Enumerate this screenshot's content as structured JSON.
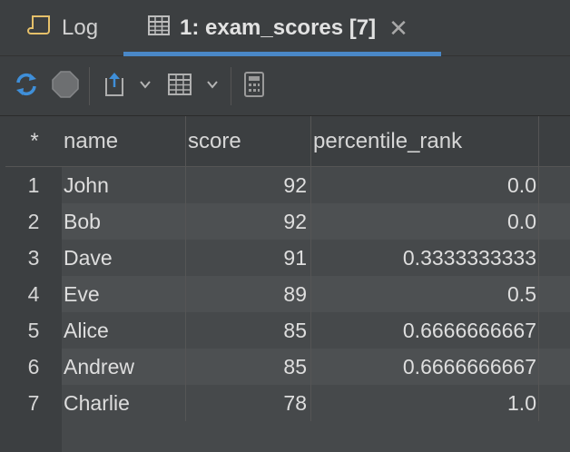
{
  "tabs": [
    {
      "label": "Log",
      "icon": "scroll-icon"
    },
    {
      "label": "1: exam_scores [7]",
      "icon": "table-icon",
      "active": true
    }
  ],
  "toolbar": {
    "icons": [
      "refresh-icon",
      "stop-icon",
      "export-icon",
      "dropdown-icon",
      "table-view-icon",
      "dropdown-icon",
      "calculator-icon"
    ]
  },
  "grid": {
    "corner": "*",
    "columns": [
      "name",
      "score",
      "percentile_rank"
    ],
    "rows": [
      {
        "num": "1",
        "name": "John",
        "score": "92",
        "percentile_rank": "0.0"
      },
      {
        "num": "2",
        "name": "Bob",
        "score": "92",
        "percentile_rank": "0.0"
      },
      {
        "num": "3",
        "name": "Dave",
        "score": "91",
        "percentile_rank": "0.3333333333"
      },
      {
        "num": "4",
        "name": "Eve",
        "score": "89",
        "percentile_rank": "0.5"
      },
      {
        "num": "5",
        "name": "Alice",
        "score": "85",
        "percentile_rank": "0.6666666667"
      },
      {
        "num": "6",
        "name": "Andrew",
        "score": "85",
        "percentile_rank": "0.6666666667"
      },
      {
        "num": "7",
        "name": "Charlie",
        "score": "78",
        "percentile_rank": "1.0"
      }
    ]
  },
  "colors": {
    "accent": "#4a88c7",
    "background": "#3c3f41",
    "row_alt": "#4d5052"
  }
}
